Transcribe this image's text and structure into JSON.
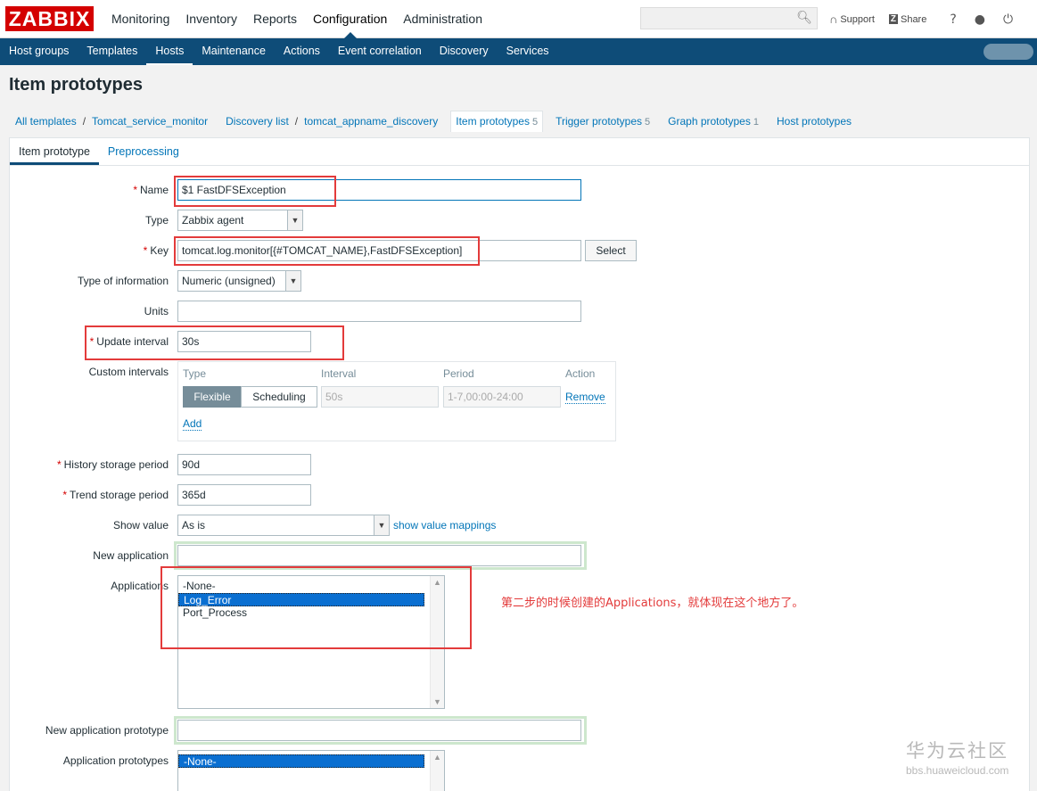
{
  "header": {
    "logo": "ZABBIX",
    "menu": [
      "Monitoring",
      "Inventory",
      "Reports",
      "Configuration",
      "Administration"
    ],
    "selected_menu": "Configuration",
    "support": "Support",
    "share": "Share",
    "help": "?"
  },
  "subnav": [
    "Host groups",
    "Templates",
    "Hosts",
    "Maintenance",
    "Actions",
    "Event correlation",
    "Discovery",
    "Services"
  ],
  "page_title": "Item prototypes",
  "breadcrumb": {
    "all_templates": "All templates",
    "template": "Tomcat_service_monitor",
    "discovery_list": "Discovery list",
    "discovery_rule": "tomcat_appname_discovery",
    "item_prototypes": "Item prototypes",
    "item_prototypes_count": "5",
    "trigger_prototypes": "Trigger prototypes",
    "trigger_prototypes_count": "5",
    "graph_prototypes": "Graph prototypes",
    "graph_prototypes_count": "1",
    "host_prototypes": "Host prototypes"
  },
  "tabs": [
    "Item prototype",
    "Preprocessing"
  ],
  "form": {
    "name_label": "Name",
    "name_value": "$1 FastDFSException",
    "type_label": "Type",
    "type_value": "Zabbix agent",
    "key_label": "Key",
    "key_value": "tomcat.log.monitor[{#TOMCAT_NAME},FastDFSException]",
    "select_button": "Select",
    "type_info_label": "Type of information",
    "type_info_value": "Numeric (unsigned)",
    "units_label": "Units",
    "units_value": "",
    "update_interval_label": "Update interval",
    "update_interval_value": "30s",
    "custom_intervals_label": "Custom intervals",
    "ci_headers": [
      "Type",
      "Interval",
      "Period",
      "Action"
    ],
    "ci_flexible": "Flexible",
    "ci_scheduling": "Scheduling",
    "ci_interval_placeholder": "50s",
    "ci_period_placeholder": "1-7,00:00-24:00",
    "ci_remove": "Remove",
    "ci_add": "Add",
    "history_label": "History storage period",
    "history_value": "90d",
    "trend_label": "Trend storage period",
    "trend_value": "365d",
    "show_value_label": "Show value",
    "show_value_value": "As is",
    "show_value_mappings": "show value mappings",
    "new_application_label": "New application",
    "applications_label": "Applications",
    "applications": [
      "-None-",
      "Log_Error",
      "Port_Process"
    ],
    "applications_selected": "Log_Error",
    "new_app_prototype_label": "New application prototype",
    "app_prototypes_label": "Application prototypes",
    "app_prototypes": [
      "-None-"
    ]
  },
  "annotation": "第二步的时候创建的Applications，就体现在这个地方了。",
  "watermark": {
    "title": "华为云社区",
    "url": "bbs.huaweicloud.com"
  },
  "colors": {
    "brand_red": "#d40000",
    "nav_blue": "#0e4c78",
    "link_blue": "#0275b8",
    "annotation_red": "#e33b3b"
  }
}
